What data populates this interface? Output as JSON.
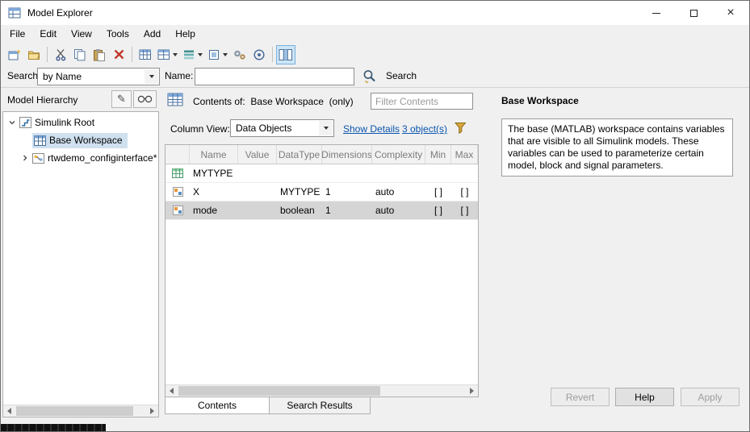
{
  "window": {
    "title": "Model Explorer",
    "close_glyph": "×"
  },
  "menu": {
    "items": [
      "File",
      "Edit",
      "View",
      "Tools",
      "Add",
      "Help"
    ]
  },
  "searchbar": {
    "search_label": "Search:",
    "mode_value": "by Name",
    "name_label": "Name:",
    "name_value": "",
    "search_button_label": "Search"
  },
  "hierarchy": {
    "title": "Model Hierarchy",
    "pencil_glyph": "✎",
    "items": [
      {
        "label": "Simulink Root"
      },
      {
        "label": "Base Workspace"
      },
      {
        "label": "rtwdemo_configinterface*"
      }
    ]
  },
  "contents": {
    "header_prefix": "Contents of:",
    "header_target": "Base Workspace",
    "header_suffix": "(only)",
    "filter_placeholder": "Filter Contents",
    "column_view_label": "Column View:",
    "column_view_value": "Data Objects",
    "show_details_link": "Show Details",
    "objects_link": "3 object(s)",
    "columns": [
      "Name",
      "Value",
      "DataType",
      "Dimensions",
      "Complexity",
      "Min",
      "Max"
    ],
    "rows": [
      {
        "name": "MYTYPE",
        "value": "",
        "datatype": "",
        "dimensions": "",
        "complexity": "",
        "min": "",
        "max": ""
      },
      {
        "name": "X",
        "value": "",
        "datatype": "MYTYPE",
        "dimensions": "1",
        "complexity": "auto",
        "min": "[ ]",
        "max": "[ ]"
      },
      {
        "name": "mode",
        "value": "",
        "datatype": "boolean",
        "dimensions": "1",
        "complexity": "auto",
        "min": "[ ]",
        "max": "[ ]"
      }
    ],
    "tabs": [
      "Contents",
      "Search Results"
    ]
  },
  "detail": {
    "title": "Base Workspace",
    "description": "The base (MATLAB) workspace contains variables that are visible to all Simulink models. These variables can be used to parameterize certain model, block and signal parameters.",
    "revert_label": "Revert",
    "help_label": "Help",
    "apply_label": "Apply"
  }
}
